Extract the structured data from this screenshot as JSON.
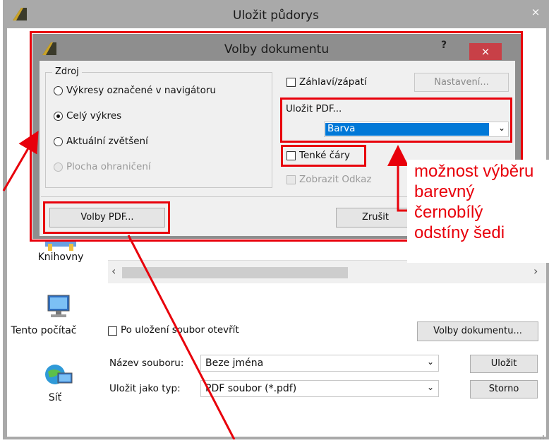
{
  "outer_window": {
    "title": "Uložit půdorys",
    "close_glyph": "×"
  },
  "sidebar": {
    "items": [
      {
        "label": "Knihovny"
      },
      {
        "label": "Tento počítač"
      },
      {
        "label": "Síť"
      }
    ]
  },
  "file_list": {
    "scroll_left": "‹",
    "scroll_right": "›"
  },
  "save_form": {
    "open_after_label": "Po uložení soubor otevřít",
    "document_options_button": "Volby dokumentu...",
    "filename_label": "Název souboru:",
    "filename_value": "Beze jména",
    "filetype_label": "Uložit jako typ:",
    "filetype_value": "PDF soubor (*.pdf)",
    "save_button": "Uložit",
    "cancel_button": "Storno"
  },
  "dialog": {
    "title": "Volby dokumentu",
    "help_glyph": "?",
    "close_glyph": "×",
    "source_group_label": "Zdroj",
    "source_options": [
      {
        "label": "Výkresy označené v navigátoru",
        "selected": false,
        "enabled": true
      },
      {
        "label": "Celý výkres",
        "selected": true,
        "enabled": true
      },
      {
        "label": "Aktuální zvětšení",
        "selected": false,
        "enabled": true
      },
      {
        "label": "Plocha ohraničení",
        "selected": false,
        "enabled": false
      }
    ],
    "header_footer_label": "Záhlaví/zápatí",
    "settings_button": "Nastavení...",
    "save_pdf_label": "Uložit PDF...",
    "color_value": "Barva",
    "thin_lines_label": "Tenké čáry",
    "show_ref_label": "Zobrazit Odkaz",
    "pdf_options_button": "Volby PDF...",
    "cancel_button": "Zrušit"
  },
  "annotation": {
    "lines": [
      "možnost výběru",
      "barevný",
      "černobílý",
      "odstíny šedi"
    ],
    "color": "#e8000b"
  },
  "colors": {
    "selection": "#0078d7",
    "close_red": "#c84047",
    "annotation_red": "#e8000b"
  }
}
